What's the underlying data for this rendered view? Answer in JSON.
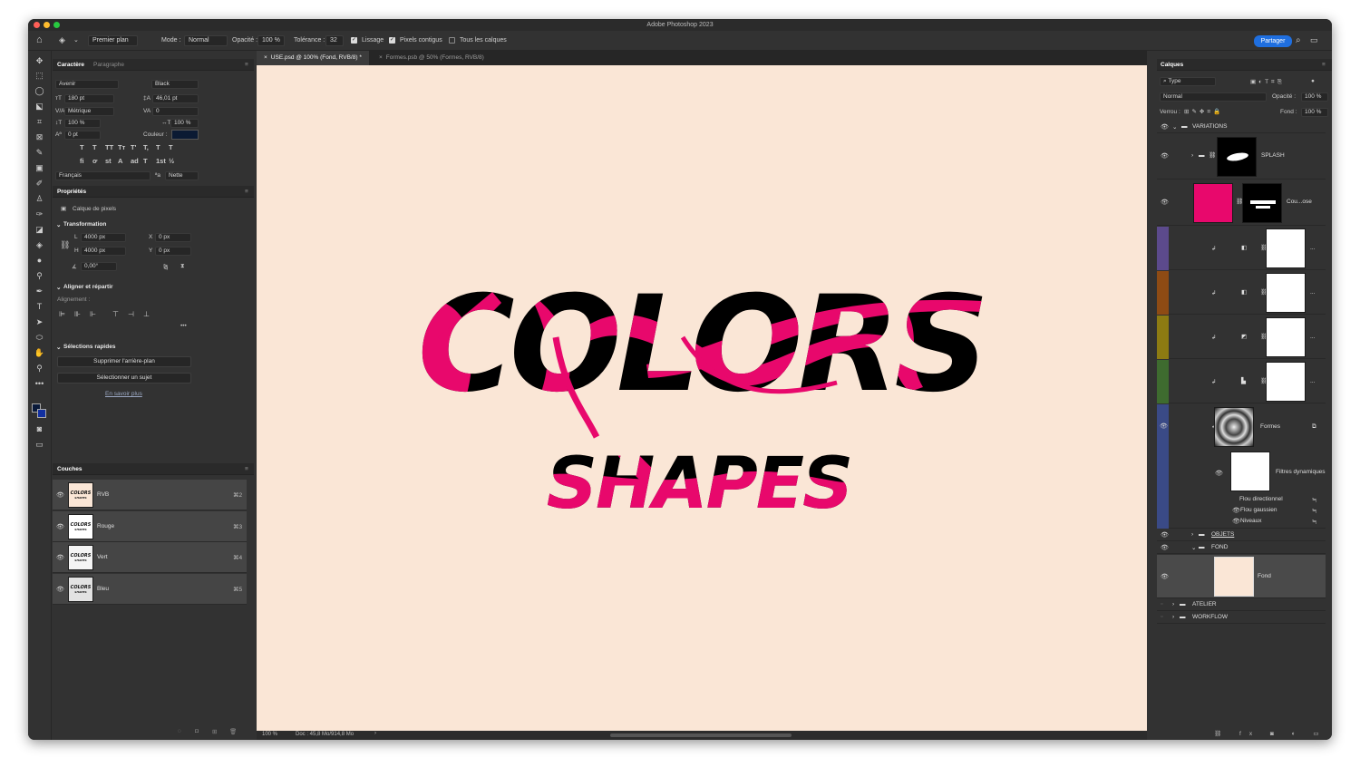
{
  "window": {
    "title": "Adobe Photoshop 2023"
  },
  "options": {
    "tool_preset": "Premier plan",
    "mode_label": "Mode :",
    "mode_value": "Normal",
    "opacity_label": "Opacité :",
    "opacity_value": "100 %",
    "tolerance_label": "Tolérance :",
    "tolerance_value": "32",
    "lissage": "Lissage",
    "contigus": "Pixels contigus",
    "tous": "Tous les calques",
    "share": "Partager"
  },
  "character": {
    "tab1": "Caractère",
    "tab2": "Paragraphe",
    "font": "Avenir",
    "style": "Black",
    "size": "180 pt",
    "leading": "46,01 pt",
    "kerning": "Métrique",
    "tracking": "0",
    "vscale": "100 %",
    "hscale": "100 %",
    "baseline": "0 pt",
    "color_label": "Couleur :",
    "language": "Français",
    "aa": "Nette",
    "glyph_row1": [
      "T",
      "T",
      "TT",
      "Tт",
      "T'",
      "T,",
      "T",
      "T"
    ],
    "glyph_row2": [
      "fi",
      "ơ",
      "st",
      "A",
      "ad",
      "T",
      "1st",
      "½"
    ]
  },
  "properties": {
    "title": "Propriétés",
    "layer_kind": "Calque de pixels",
    "transform": "Transformation",
    "L_label": "L",
    "L": "4000 px",
    "H_label": "H",
    "H": "4000 px",
    "X_label": "X",
    "X": "0 px",
    "Y_label": "Y",
    "Y": "0 px",
    "angle": "0,00°",
    "align": "Aligner et répartir",
    "alignment_label": "Alignement :",
    "quick": "Sélections rapides",
    "btn1": "Supprimer l'arrière-plan",
    "btn2": "Sélectionner un sujet",
    "learn": "En savoir plus"
  },
  "channels": {
    "title": "Couches",
    "rows": [
      {
        "name": "RVB",
        "key": "⌘2"
      },
      {
        "name": "Rouge",
        "key": "⌘3"
      },
      {
        "name": "Vert",
        "key": "⌘4"
      },
      {
        "name": "Bleu",
        "key": "⌘5"
      }
    ]
  },
  "thumb_text": {
    "top": "COLORS",
    "bottom": "SHAPES"
  },
  "tabs": [
    {
      "label": "USE.psd @ 100% (Fond, RVB/8) *"
    },
    {
      "label": "Formes.psb @ 50% (Formes, RVB/8)"
    }
  ],
  "artwork": {
    "line1": "COLORS",
    "line2": "SHAPES"
  },
  "status": {
    "zoom": "100 %",
    "doc": "Doc : 45,8 Mo/914,8 Mo"
  },
  "layers": {
    "title": "Calques",
    "filter": "Type",
    "blend": "Normal",
    "opacity_label": "Opacité :",
    "opacity": "100 %",
    "lock_label": "Verrou :",
    "fill_label": "Fond :",
    "fill": "100 %",
    "items": {
      "variations": "VARIATIONS",
      "splash": "SPLASH",
      "couleur": "Cou...ose",
      "formes": "Formes",
      "filtres": "Filtres dynamiques",
      "flou_dir": "Flou directionnel",
      "flou_gauss": "Flou gaussien",
      "niveaux": "Niveaux",
      "objets": "OBJETS",
      "fond_group": "FOND",
      "fond": "Fond",
      "atelier": "ATELIER",
      "workflow": "WORKFLOW",
      "ellipsis": "..."
    }
  },
  "colors": {
    "canvas": "#fae6d6",
    "accent_pink": "#e8086c",
    "share_blue": "#1f6fe0",
    "violet": "#5c4a8c",
    "orange": "#8e4b14",
    "yellow": "#8d7b12",
    "green": "#3e6b2f",
    "blue": "#3a4a86",
    "red": "#8a2020"
  }
}
